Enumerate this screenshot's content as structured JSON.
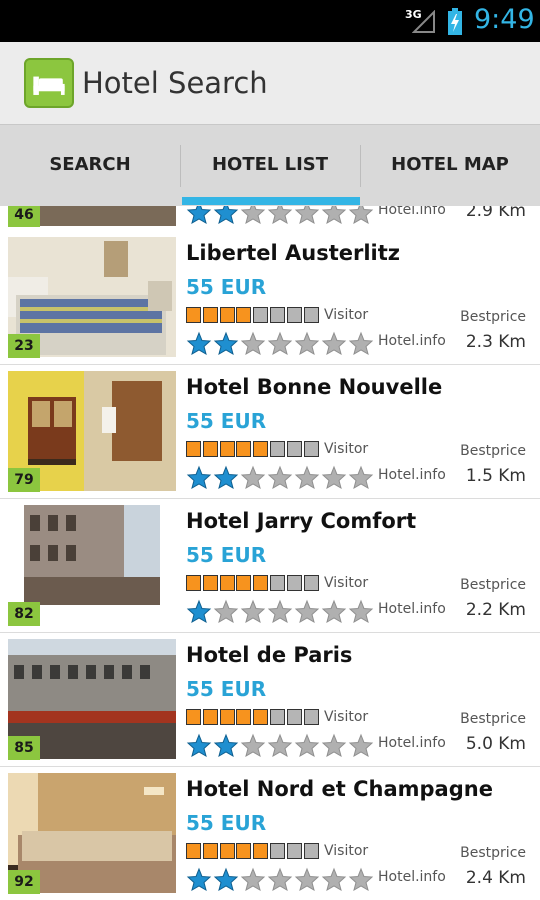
{
  "status": {
    "network": "3G",
    "time": "9:49",
    "accent": "#33b5e5"
  },
  "app": {
    "title": "Hotel Search",
    "icon": "bed-icon",
    "brand_color": "#8cc63f"
  },
  "tabs": [
    {
      "label": "SEARCH",
      "selected": false
    },
    {
      "label": "HOTEL LIST",
      "selected": true
    },
    {
      "label": "HOTEL MAP",
      "selected": false
    }
  ],
  "colors": {
    "price": "#29a3d6",
    "rating_on": "#f7931e",
    "rating_off": "#b5b5b5",
    "star_on": "#1f8fd0",
    "star_off": "#b0b0b0",
    "badge": "#8cc63f"
  },
  "hotels": [
    {
      "name": "",
      "price": "",
      "score": "46",
      "visitor_segments": 0,
      "stars": 2,
      "provider": "Hotel.info",
      "bestprice_label": "",
      "distance": "2.9 Km",
      "visitor_label": ""
    },
    {
      "name": "Libertel Austerlitz",
      "price": "55 EUR",
      "score": "23",
      "visitor_segments": 4,
      "stars": 2,
      "provider": "Hotel.info",
      "bestprice_label": "Bestprice",
      "distance": "2.3 Km",
      "visitor_label": "Visitor"
    },
    {
      "name": "Hotel Bonne Nouvelle",
      "price": "55 EUR",
      "score": "79",
      "visitor_segments": 5,
      "stars": 2,
      "provider": "Hotel.info",
      "bestprice_label": "Bestprice",
      "distance": "1.5 Km",
      "visitor_label": "Visitor"
    },
    {
      "name": "Hotel Jarry Comfort",
      "price": "55 EUR",
      "score": "82",
      "visitor_segments": 5,
      "stars": 1,
      "provider": "Hotel.info",
      "bestprice_label": "Bestprice",
      "distance": "2.2 Km",
      "visitor_label": "Visitor"
    },
    {
      "name": "Hotel de Paris",
      "price": "55 EUR",
      "score": "85",
      "visitor_segments": 5,
      "stars": 2,
      "provider": "Hotel.info",
      "bestprice_label": "Bestprice",
      "distance": "5.0 Km",
      "visitor_label": "Visitor"
    },
    {
      "name": "Hotel Nord et Champagne",
      "price": "55 EUR",
      "score": "92",
      "visitor_segments": 5,
      "stars": 2,
      "provider": "Hotel.info",
      "bestprice_label": "Bestprice",
      "distance": "2.4 Km",
      "visitor_label": "Visitor"
    }
  ]
}
